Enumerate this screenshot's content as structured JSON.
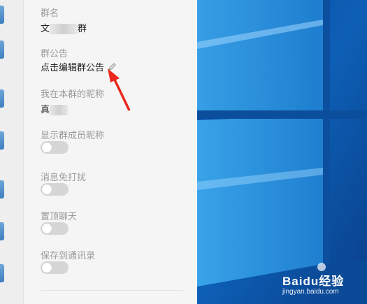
{
  "group_settings": {
    "group_name_label": "群名",
    "group_name_value_start": "文",
    "group_name_value_end": "群",
    "announcement_label": "群公告",
    "announcement_action": "点击编辑群公告",
    "nickname_label": "我在本群的昵称",
    "nickname_value_start": "真",
    "show_nicknames_label": "显示群成员昵称",
    "show_nicknames_on": false,
    "mute_label": "消息免打扰",
    "mute_on": false,
    "pin_label": "置顶聊天",
    "pin_on": false,
    "save_contacts_label": "保存到通讯录",
    "save_contacts_on": false
  },
  "watermark": {
    "brand": "Baidu经验",
    "url": "jingyan.baidu.com"
  },
  "colors": {
    "panel_bg": "#f5f5f5",
    "toggle_off": "#d6d6d6",
    "arrow": "#e8291c",
    "wallpaper_blue": "#0d5fb5"
  }
}
